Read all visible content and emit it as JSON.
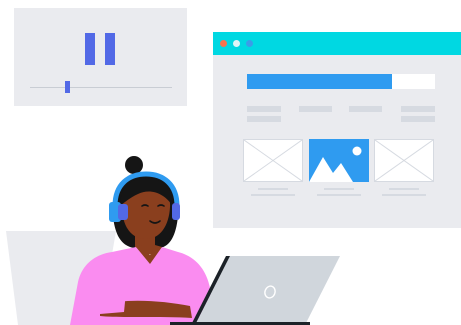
{
  "colors": {
    "accent_blue": "#2f9bf0",
    "cyan": "#00d8e2",
    "indigo": "#5269e6",
    "panel": "#eaebef",
    "line": "#d6dae1",
    "skin": "#8a3f1e",
    "hair": "#151515",
    "shirt": "#fa8cf0",
    "laptop": "#d0d6dc",
    "laptop_dark": "#1c2228",
    "dot_red": "#f7734c",
    "dot_light": "#dff4f7",
    "dot_blue": "#3b9de8"
  },
  "player": {
    "state_icon": "pause-icon",
    "seek_position": 0.26
  },
  "browser": {
    "window_dots": [
      "close-dot",
      "minimize-dot",
      "maximize-dot"
    ],
    "progress": 0.77,
    "thumbnails": [
      "placeholder-image",
      "landscape-image",
      "placeholder-image"
    ]
  },
  "person": {
    "accessory": "headphones",
    "device": "laptop"
  }
}
